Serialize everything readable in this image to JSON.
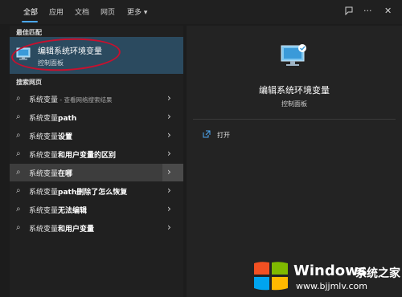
{
  "tabs": [
    "全部",
    "应用",
    "文档",
    "网页",
    "更多"
  ],
  "more_caret": "▾",
  "best_match": {
    "section": "最佳匹配",
    "title": "编辑系统环境变量",
    "subtitle": "控制面板"
  },
  "search_section": "搜索网页",
  "results": [
    {
      "prefix": "系统变量",
      "bold": "",
      "suffix": " - 查看网络搜索结果"
    },
    {
      "prefix": "系统变量",
      "bold": "path",
      "suffix": ""
    },
    {
      "prefix": "系统变量",
      "bold": "设置",
      "suffix": ""
    },
    {
      "prefix": "系统变量",
      "bold": "和用户变量的区别",
      "suffix": ""
    },
    {
      "prefix": "系统变量",
      "bold": "在哪",
      "suffix": ""
    },
    {
      "prefix": "系统变量",
      "bold": "path删除了怎么恢复",
      "suffix": ""
    },
    {
      "prefix": "系统变量",
      "bold": "无法编辑",
      "suffix": ""
    },
    {
      "prefix": "系统变量",
      "bold": "和用户变量",
      "suffix": ""
    }
  ],
  "detail": {
    "title": "编辑系统环境变量",
    "subtitle": "控制面板",
    "open_label": "打开"
  },
  "watermark": {
    "brand": "Windows",
    "cn": "系统之家",
    "url": "www.bjjmlv.com"
  },
  "colors": {
    "accent": "#4ca8f4",
    "selected_row": "#2b4a5f",
    "annotation_red": "#c8102e"
  }
}
